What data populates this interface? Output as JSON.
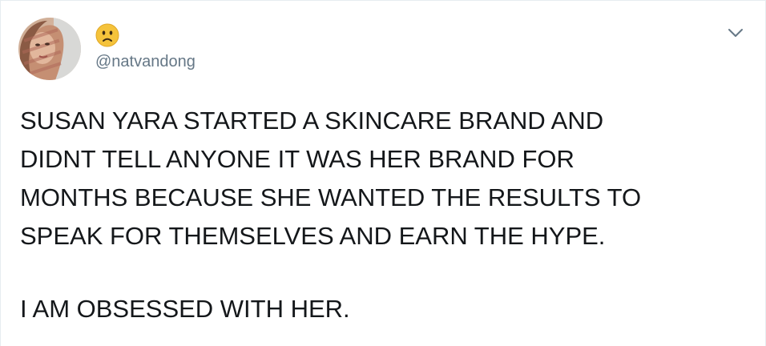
{
  "tweet": {
    "display_name_emoji": "🙁",
    "handle": "@natvandong",
    "menu_icon": "chevron-down-icon",
    "text_lines": [
      "SUSAN YARA STARTED A SKINCARE BRAND AND",
      "DIDNT TELL ANYONE IT WAS HER BRAND FOR",
      "MONTHS BECAUSE SHE WANTED THE RESULTS TO",
      "SPEAK FOR THEMSELVES AND EARN THE HYPE."
    ],
    "text_line_final": "I AM OBSESSED WITH HER."
  },
  "colors": {
    "text": "#14171a",
    "secondary_text": "#657786",
    "border": "#e6ecf0",
    "emoji_face": "#f5c33b"
  }
}
